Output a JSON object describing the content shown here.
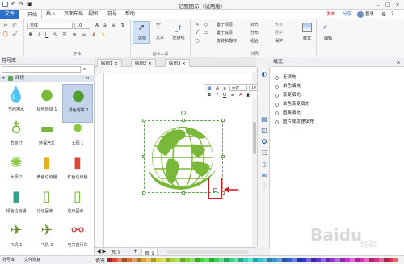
{
  "app": {
    "title": "亿图图示（试用版）"
  },
  "window": {
    "min": "–",
    "max": "□",
    "close": "×"
  },
  "menu": {
    "tabs": [
      "文件",
      "开始",
      "插入",
      "页面布局",
      "视图",
      "符号",
      "帮助"
    ],
    "right": {
      "publish": "发布",
      "share": "分享",
      "login": "登录"
    }
  },
  "ribbon": {
    "font": {
      "name": "宋体",
      "size": "10",
      "label": "字体"
    },
    "tools": {
      "select": "选择",
      "text": "文本",
      "connector": "连接线",
      "label": "基本工具"
    },
    "arrange": {
      "bring_front": "置于顶层",
      "send_back": "置于底层",
      "rotate_flip": "旋转和翻转",
      "align": "对齐",
      "distribute": "分布",
      "group": "组合",
      "size": "大小",
      "center": "居中",
      "protect": "保护",
      "label": "排列"
    },
    "style": {
      "label": "样式"
    },
    "edit": {
      "label": "编辑"
    }
  },
  "library": {
    "title": "符号库",
    "category": "环境",
    "symbols": [
      {
        "label": "节约用水",
        "icon": "water-drop-hand-icon"
      },
      {
        "label": "绿色地球 1",
        "icon": "green-globe-1-icon"
      },
      {
        "label": "绿色地球 2",
        "icon": "green-globe-2-icon",
        "selected": true
      },
      {
        "label": "节能灯",
        "icon": "energy-lamp-icon"
      },
      {
        "label": "环保汽车",
        "icon": "eco-car-icon"
      },
      {
        "label": "太阳 1",
        "icon": "sun-1-icon"
      },
      {
        "label": "太阳 2",
        "icon": "sun-2-icon"
      },
      {
        "label": "黄色垃圾桶",
        "icon": "yellow-bin-icon"
      },
      {
        "label": "红色垃圾桶",
        "icon": "red-bin-icon"
      },
      {
        "label": "绿色垃圾桶",
        "icon": "green-bin-icon"
      },
      {
        "label": "垃圾回收...",
        "icon": "recycle-bin-icon"
      },
      {
        "label": "垃圾回收...",
        "icon": "recycle-bin-2-icon"
      },
      {
        "label": "飞机 1",
        "icon": "airplane-1-icon"
      },
      {
        "label": "飞机 2",
        "icon": "airplane-2-icon"
      },
      {
        "label": "可共自行车",
        "icon": "bicycle-icon"
      }
    ],
    "bottom_tabs": [
      "符号库",
      "文件恢复"
    ]
  },
  "doc_tabs": [
    "绘图1",
    "绘图2",
    "绘图3"
  ],
  "mini_toolbar": {
    "font": "宋体",
    "size": "10"
  },
  "page_bar": {
    "page": "页-1",
    "tab": "页-1"
  },
  "palette_label": "填充",
  "fill_panel": {
    "title": "填充",
    "options": [
      "无填充",
      "单色填充",
      "渐变填充",
      "单色渐变填充",
      "图案填充",
      "图片或纹理填充"
    ]
  },
  "colors": {
    "accent": "#2a6fc9",
    "globe": "#7ab83a",
    "callout": "#d11b1b"
  }
}
